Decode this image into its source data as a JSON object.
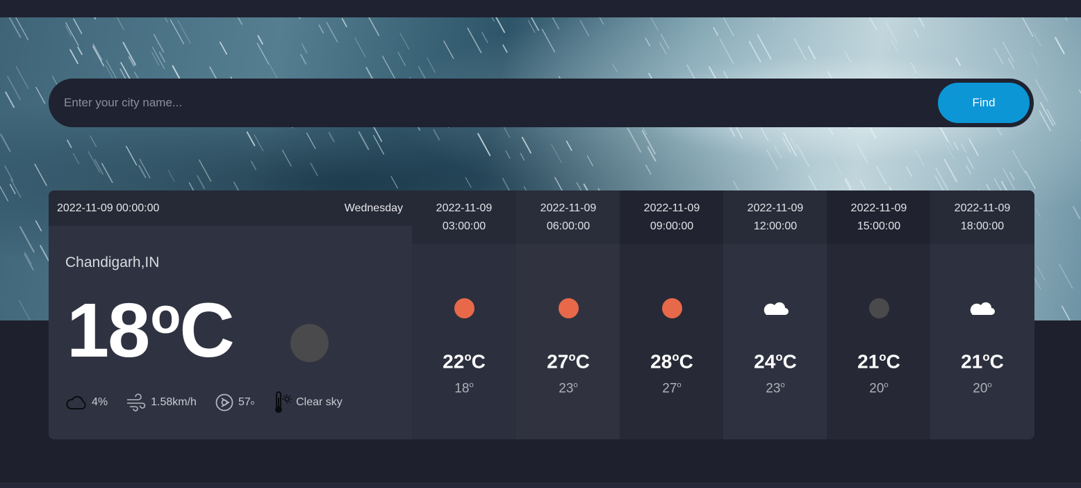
{
  "search": {
    "placeholder": "Enter your city name...",
    "value": "",
    "button_label": "Find"
  },
  "current": {
    "datetime": "2022-11-09 00:00:00",
    "weekday": "Wednesday",
    "city": "Chandigarh,IN",
    "temp": "18",
    "unit": "C",
    "icon": "moon-icon",
    "clouds": "4%",
    "wind": "1.58km/h",
    "wind_direction": "57",
    "description": "Clear sky"
  },
  "forecast": [
    {
      "date": "2022-11-09",
      "time": "03:00:00",
      "icon": "sun-icon",
      "temp": "22",
      "low": "18"
    },
    {
      "date": "2022-11-09",
      "time": "06:00:00",
      "icon": "sun-icon",
      "temp": "27",
      "low": "23"
    },
    {
      "date": "2022-11-09",
      "time": "09:00:00",
      "icon": "sun-icon",
      "temp": "28",
      "low": "27"
    },
    {
      "date": "2022-11-09",
      "time": "12:00:00",
      "icon": "cloud-icon",
      "temp": "24",
      "low": "23"
    },
    {
      "date": "2022-11-09",
      "time": "15:00:00",
      "icon": "moon-icon",
      "temp": "21",
      "low": "20"
    },
    {
      "date": "2022-11-09",
      "time": "18:00:00",
      "icon": "cloud-icon",
      "temp": "21",
      "low": "20"
    }
  ],
  "colors": {
    "accent": "#0d96d6",
    "sun": "#e8694a",
    "moon": "#4a4a4c",
    "card": "#2f3241",
    "background": "#1e212d"
  }
}
